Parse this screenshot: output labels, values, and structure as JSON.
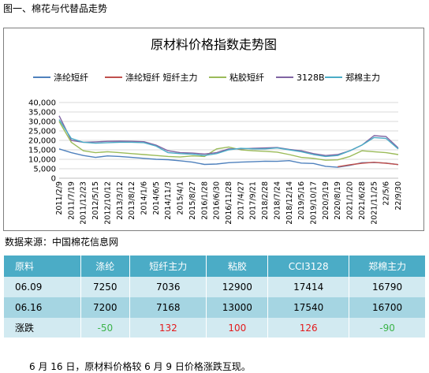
{
  "figure_title": "图一、棉花与代替品走势",
  "source_text": "数据来源：中国棉花信息网",
  "note_text": "6 月 16 日，原材料价格较 6 月 9 日价格涨跌互现。",
  "chart_data": {
    "type": "line",
    "title": "原材料价格指数走势图",
    "ylim": [
      0,
      40000
    ],
    "y_ticks": [
      "0",
      "5,000",
      "10,000",
      "15,000",
      "20,000",
      "25,000",
      "30,000",
      "35,000",
      "40,000"
    ],
    "x_tick_labels": [
      "2011/2/9",
      "2011/7/19",
      "2011/12/23",
      "2012/5/15",
      "2012/10/12",
      "2013/3/12",
      "2013/8/12",
      "2014/1/6",
      "2014/6/5",
      "2014/11/3",
      "2015/4/1",
      "2015/8/27",
      "2016/1/28",
      "2016/6/30",
      "2016/11/28",
      "2017/4/27",
      "2017/9/21",
      "2018/2/28",
      "2018/7/24",
      "2018/12/14",
      "2019/5/16",
      "2019/10/17",
      "2020/3/19",
      "2020/8/19",
      "2021/1/20",
      "2021/6/28",
      "2021/11/25",
      "22/5/6",
      "22/9/30"
    ],
    "grid": true,
    "legend_position": "top",
    "series": [
      {
        "name": "涤纶短纤",
        "color": "#4f81bd",
        "values": [
          15500,
          13500,
          12000,
          11000,
          11800,
          11500,
          11000,
          10500,
          10000,
          9800,
          9200,
          8500,
          7300,
          7500,
          8200,
          8500,
          8700,
          9000,
          8900,
          9300,
          8000,
          7800,
          6300,
          5800,
          6800,
          8200,
          8300,
          8000,
          7200
        ]
      },
      {
        "name": "涤纶短纤 短纤主力",
        "color": "#c0504d",
        "values": [
          null,
          null,
          null,
          null,
          null,
          null,
          null,
          null,
          null,
          null,
          null,
          null,
          null,
          null,
          null,
          null,
          null,
          null,
          null,
          null,
          null,
          null,
          null,
          6100,
          7100,
          7900,
          8400,
          7900,
          7200
        ]
      },
      {
        "name": "粘胶短纤",
        "color": "#9bbb59",
        "values": [
          30000,
          19000,
          14500,
          13500,
          14000,
          13500,
          13000,
          12500,
          12000,
          11500,
          11200,
          11800,
          11500,
          15500,
          16500,
          15000,
          14500,
          14200,
          13800,
          12500,
          11000,
          10500,
          9500,
          9700,
          11500,
          14500,
          14000,
          13500,
          12500
        ]
      },
      {
        "name": "3128B",
        "color": "#8064a2",
        "values": [
          33000,
          20000,
          19000,
          19200,
          19500,
          19600,
          19500,
          19300,
          17500,
          14500,
          13500,
          13300,
          12800,
          13500,
          15500,
          15500,
          15800,
          16000,
          16200,
          15200,
          14500,
          13000,
          12000,
          12500,
          14500,
          17500,
          22500,
          22000,
          16000
        ]
      },
      {
        "name": "郑棉主力",
        "color": "#4bacc6",
        "values": [
          31000,
          21000,
          19000,
          18500,
          18800,
          19000,
          19000,
          18800,
          17000,
          13500,
          13000,
          12700,
          12000,
          13000,
          15000,
          15800,
          15500,
          15500,
          16000,
          15000,
          14000,
          12500,
          11500,
          12000,
          14500,
          17500,
          21500,
          21000,
          15500
        ]
      }
    ]
  },
  "table": {
    "headers": [
      "原料",
      "涤纶",
      "短纤主力",
      "粘胶",
      "CCI3128",
      "郑棉主力"
    ],
    "rows": [
      [
        "06.09",
        "7250",
        "7036",
        "12900",
        "17414",
        "16790"
      ],
      [
        "06.16",
        "7200",
        "7168",
        "13000",
        "17540",
        "16700"
      ],
      [
        "涨跌",
        "-50",
        "132",
        "100",
        "126",
        "-90"
      ]
    ],
    "change_colors": {
      "up": "#e31a1c",
      "down": "#3cb34a"
    }
  }
}
